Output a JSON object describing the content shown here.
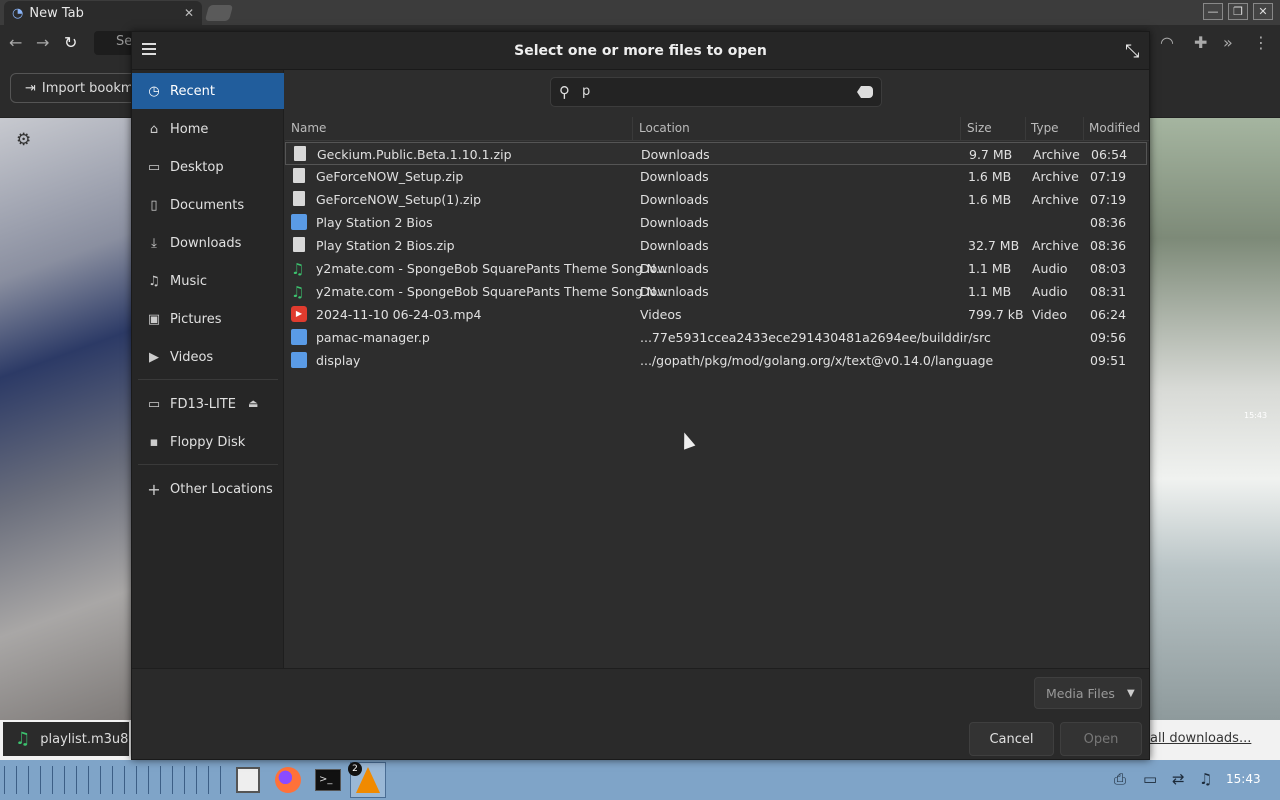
{
  "browser": {
    "tab_title": "New Tab",
    "omnibox_partial": "Se",
    "bookmark_import_label": "Import bookmar"
  },
  "dialog": {
    "title": "Select one or more files to open",
    "search_value": "p",
    "sidebar": {
      "items": [
        {
          "label": "Recent",
          "icon": "clock-icon",
          "selected": true
        },
        {
          "label": "Home",
          "icon": "home-icon"
        },
        {
          "label": "Desktop",
          "icon": "folder-icon"
        },
        {
          "label": "Documents",
          "icon": "document-icon"
        },
        {
          "label": "Downloads",
          "icon": "download-icon"
        },
        {
          "label": "Music",
          "icon": "music-icon"
        },
        {
          "label": "Pictures",
          "icon": "picture-icon"
        },
        {
          "label": "Videos",
          "icon": "video-icon"
        },
        {
          "label": "FD13-LITE",
          "icon": "drive-icon"
        },
        {
          "label": "Floppy Disk",
          "icon": "floppy-icon"
        },
        {
          "label": "Other Locations",
          "icon": "plus-icon"
        }
      ]
    },
    "columns": {
      "name": "Name",
      "location": "Location",
      "size": "Size",
      "type": "Type",
      "modified": "Modified"
    },
    "files": [
      {
        "name": "Geckium.Public.Beta.1.10.1.zip",
        "location": "Downloads",
        "size": "9.7 MB",
        "type": "Archive",
        "modified": "06:54",
        "icon": "archive"
      },
      {
        "name": "GeForceNOW_Setup.zip",
        "location": "Downloads",
        "size": "1.6 MB",
        "type": "Archive",
        "modified": "07:19",
        "icon": "archive"
      },
      {
        "name": "GeForceNOW_Setup(1).zip",
        "location": "Downloads",
        "size": "1.6 MB",
        "type": "Archive",
        "modified": "07:19",
        "icon": "archive"
      },
      {
        "name": "Play Station 2 Bios",
        "location": "Downloads",
        "size": "",
        "type": "",
        "modified": "08:36",
        "icon": "folder"
      },
      {
        "name": "Play Station 2 Bios.zip",
        "location": "Downloads",
        "size": "32.7 MB",
        "type": "Archive",
        "modified": "08:36",
        "icon": "archive"
      },
      {
        "name": "y2mate.com - SpongeBob SquarePants Theme Song N...",
        "location": "Downloads",
        "size": "1.1 MB",
        "type": "Audio",
        "modified": "08:03",
        "icon": "audio"
      },
      {
        "name": "y2mate.com - SpongeBob SquarePants Theme Song N...",
        "location": "Downloads",
        "size": "1.1 MB",
        "type": "Audio",
        "modified": "08:31",
        "icon": "audio"
      },
      {
        "name": "2024-11-10 06-24-03.mp4",
        "location": "Videos",
        "size": "799.7 kB",
        "type": "Video",
        "modified": "06:24",
        "icon": "video"
      },
      {
        "name": "pamac-manager.p",
        "location": "...77e5931ccea2433ece291430481a2694ee/builddir/src",
        "size": "",
        "type": "",
        "modified": "09:56",
        "icon": "folder"
      },
      {
        "name": "display",
        "location": ".../gopath/pkg/mod/golang.org/x/text@v0.14.0/language",
        "size": "",
        "type": "",
        "modified": "09:51",
        "icon": "folder"
      }
    ],
    "filter_label": "Media Files",
    "cancel_label": "Cancel",
    "open_label": "Open"
  },
  "downloads_bar": {
    "item_label": "playlist.m3u8",
    "show_all_label": "all downloads..."
  },
  "overlay_time": "15:43",
  "taskbar": {
    "badge_count": "2",
    "clock": "15:43"
  }
}
